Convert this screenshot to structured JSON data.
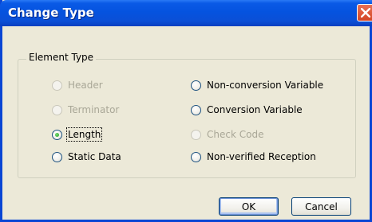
{
  "window": {
    "title": "Change Type"
  },
  "group": {
    "label": "Element Type"
  },
  "options_left": [
    {
      "label": "Header",
      "checked": false,
      "disabled": true
    },
    {
      "label": "Terminator",
      "checked": false,
      "disabled": true
    },
    {
      "label": "Length",
      "checked": true,
      "disabled": false
    },
    {
      "label": "Static Data",
      "checked": false,
      "disabled": false
    }
  ],
  "options_right": [
    {
      "label": "Non-conversion Variable",
      "checked": false,
      "disabled": false
    },
    {
      "label": "Conversion Variable",
      "checked": false,
      "disabled": false
    },
    {
      "label": "Check Code",
      "checked": false,
      "disabled": true
    },
    {
      "label": "Non-verified Reception",
      "checked": false,
      "disabled": false
    }
  ],
  "buttons": {
    "ok": "OK",
    "cancel": "Cancel"
  },
  "icons": {
    "close": "close-icon",
    "radio": "radio-icon"
  },
  "colors": {
    "titlebar": "#0553df",
    "face": "#ece9d8",
    "close": "#d34524",
    "radio_dot": "#21a121"
  }
}
